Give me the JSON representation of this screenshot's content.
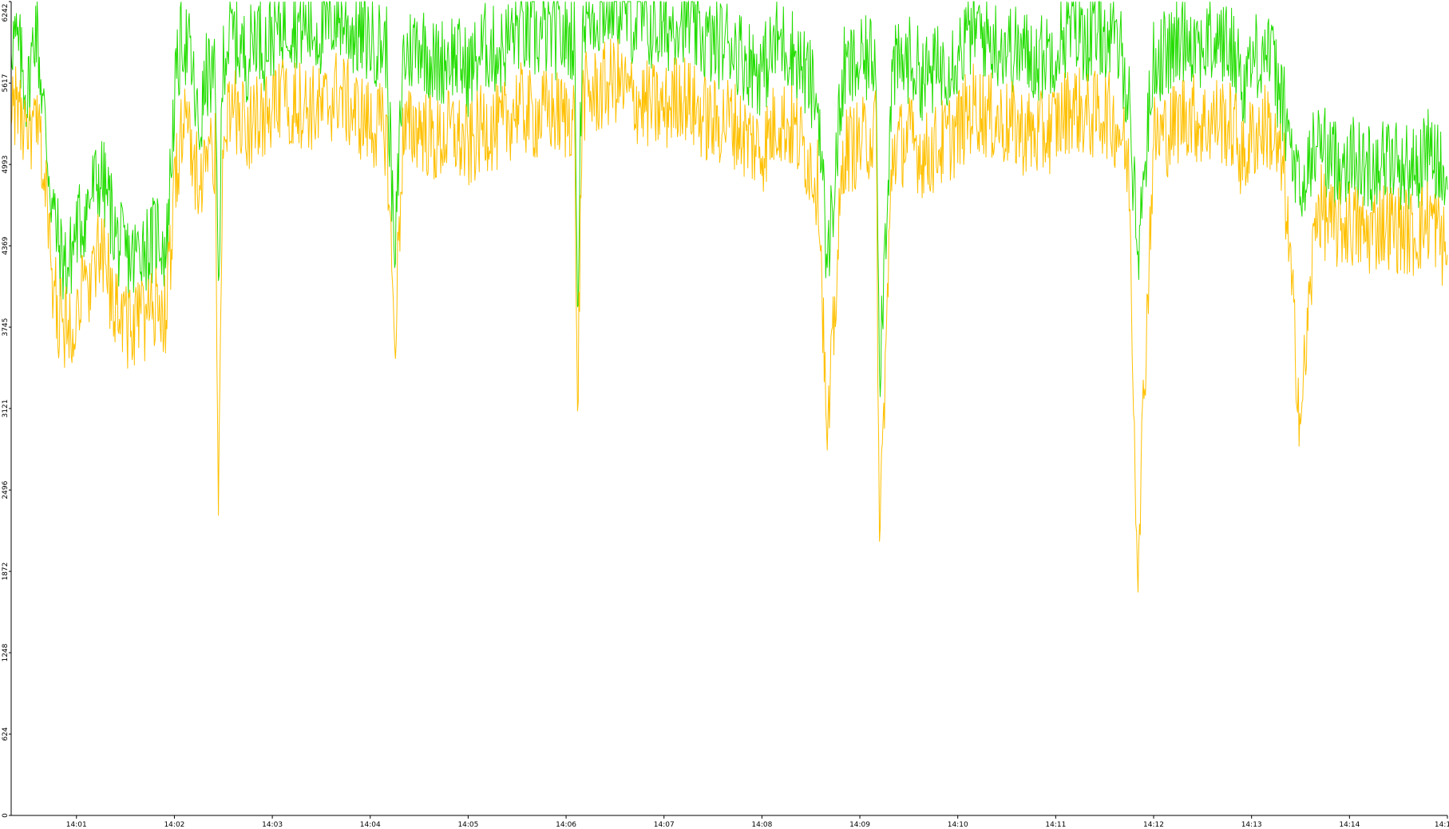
{
  "chart_data": {
    "type": "line",
    "title": "",
    "xlabel": "",
    "ylabel": "",
    "x_range": [
      "14:00:20",
      "14:15:00"
    ],
    "ylim": [
      0,
      6242
    ],
    "y_ticks": [
      0,
      624,
      1248,
      1872,
      2496,
      3121,
      3745,
      4369,
      4993,
      5617,
      6242
    ],
    "x_ticks": [
      {
        "t": "14:01:00",
        "label": "14:01"
      },
      {
        "t": "14:02:00",
        "label": "14:02"
      },
      {
        "t": "14:03:00",
        "label": "14:03"
      },
      {
        "t": "14:04:00",
        "label": "14:04"
      },
      {
        "t": "14:05:00",
        "label": "14:05"
      },
      {
        "t": "14:06:00",
        "label": "14:06"
      },
      {
        "t": "14:07:00",
        "label": "14:07"
      },
      {
        "t": "14:08:00",
        "label": "14:08"
      },
      {
        "t": "14:09:00",
        "label": "14:09"
      },
      {
        "t": "14:10:00",
        "label": "14:10"
      },
      {
        "t": "14:11:00",
        "label": "14:11"
      },
      {
        "t": "14:12:00",
        "label": "14:12"
      },
      {
        "t": "14:13:00",
        "label": "14:13"
      },
      {
        "t": "14:14:00",
        "label": "14:14"
      },
      {
        "t": "14:15:00",
        "label": "14:1"
      }
    ],
    "grid": false,
    "legend": "none",
    "series": [
      {
        "color": "#22dd00",
        "x": [
          "14:00:20",
          "14:00:25",
          "14:00:30",
          "14:00:35",
          "14:00:40",
          "14:00:45",
          "14:00:50",
          "14:00:55",
          "14:01:00",
          "14:01:05",
          "14:01:10",
          "14:01:15",
          "14:01:20",
          "14:01:25",
          "14:01:30",
          "14:01:35",
          "14:01:40",
          "14:01:45",
          "14:01:50",
          "14:01:55",
          "14:02:00",
          "14:02:05",
          "14:02:10",
          "14:02:15",
          "14:02:20",
          "14:02:25",
          "14:02:27",
          "14:02:30",
          "14:02:35",
          "14:02:40",
          "14:02:45",
          "14:02:50",
          "14:02:55",
          "14:03:00",
          "14:03:10",
          "14:03:20",
          "14:03:30",
          "14:03:40",
          "14:03:50",
          "14:04:00",
          "14:04:10",
          "14:04:15",
          "14:04:20",
          "14:04:30",
          "14:04:40",
          "14:04:50",
          "14:05:00",
          "14:05:10",
          "14:05:20",
          "14:05:30",
          "14:05:40",
          "14:05:50",
          "14:06:00",
          "14:06:05",
          "14:06:07",
          "14:06:10",
          "14:06:20",
          "14:06:30",
          "14:06:40",
          "14:06:50",
          "14:07:00",
          "14:07:10",
          "14:07:20",
          "14:07:30",
          "14:07:40",
          "14:07:50",
          "14:08:00",
          "14:08:10",
          "14:08:20",
          "14:08:30",
          "14:08:35",
          "14:08:40",
          "14:08:50",
          "14:09:00",
          "14:09:10",
          "14:09:12",
          "14:09:20",
          "14:09:30",
          "14:09:40",
          "14:09:50",
          "14:10:00",
          "14:10:10",
          "14:10:20",
          "14:10:30",
          "14:10:40",
          "14:10:50",
          "14:11:00",
          "14:11:10",
          "14:11:20",
          "14:11:30",
          "14:11:40",
          "14:11:45",
          "14:11:50",
          "14:12:00",
          "14:12:10",
          "14:12:20",
          "14:12:30",
          "14:12:40",
          "14:12:50",
          "14:12:55",
          "14:13:00",
          "14:13:10",
          "14:13:20",
          "14:13:30",
          "14:13:40",
          "14:13:50",
          "14:14:00",
          "14:14:10",
          "14:14:20",
          "14:14:30",
          "14:14:40",
          "14:14:50",
          "14:15:00"
        ],
        "y": [
          6000,
          5850,
          5500,
          6100,
          5400,
          4700,
          4300,
          4200,
          4500,
          4600,
          4800,
          4900,
          4700,
          4400,
          4300,
          4250,
          4400,
          4350,
          4500,
          4300,
          5500,
          6000,
          5800,
          5200,
          5700,
          5600,
          4100,
          5850,
          6000,
          5900,
          5800,
          6050,
          5900,
          6000,
          6100,
          6050,
          6000,
          6150,
          6000,
          5950,
          5900,
          4200,
          5800,
          5950,
          5750,
          5850,
          5700,
          5900,
          5850,
          6050,
          5950,
          6000,
          5950,
          6000,
          3900,
          6100,
          6150,
          6250,
          6100,
          6050,
          6000,
          6150,
          6000,
          5900,
          5950,
          5800,
          5700,
          5950,
          5850,
          5600,
          5400,
          4200,
          5700,
          5750,
          5850,
          3400,
          5700,
          5800,
          5650,
          5750,
          5850,
          6050,
          5950,
          5900,
          5850,
          5800,
          5900,
          6050,
          5950,
          6000,
          5850,
          5500,
          4300,
          5800,
          5850,
          6000,
          5900,
          5950,
          5850,
          5600,
          5800,
          5900,
          5400,
          4700,
          5200,
          5000,
          5050,
          4950,
          5050,
          5000,
          4950,
          5100,
          4800
        ]
      },
      {
        "color": "#ffc000",
        "x": [
          "14:00:20",
          "14:00:25",
          "14:00:30",
          "14:00:35",
          "14:00:40",
          "14:00:45",
          "14:00:50",
          "14:00:55",
          "14:01:00",
          "14:01:05",
          "14:01:10",
          "14:01:15",
          "14:01:20",
          "14:01:25",
          "14:01:30",
          "14:01:35",
          "14:01:40",
          "14:01:45",
          "14:01:50",
          "14:01:55",
          "14:02:00",
          "14:02:05",
          "14:02:10",
          "14:02:15",
          "14:02:20",
          "14:02:25",
          "14:02:27",
          "14:02:30",
          "14:02:35",
          "14:02:40",
          "14:02:45",
          "14:02:50",
          "14:02:55",
          "14:03:00",
          "14:03:10",
          "14:03:20",
          "14:03:30",
          "14:03:40",
          "14:03:50",
          "14:04:00",
          "14:04:10",
          "14:04:15",
          "14:04:20",
          "14:04:30",
          "14:04:40",
          "14:04:50",
          "14:05:00",
          "14:05:10",
          "14:05:20",
          "14:05:30",
          "14:05:40",
          "14:05:50",
          "14:06:00",
          "14:06:05",
          "14:06:07",
          "14:06:10",
          "14:06:20",
          "14:06:30",
          "14:06:40",
          "14:06:50",
          "14:07:00",
          "14:07:10",
          "14:07:20",
          "14:07:30",
          "14:07:40",
          "14:07:50",
          "14:08:00",
          "14:08:10",
          "14:08:20",
          "14:08:30",
          "14:08:35",
          "14:08:40",
          "14:08:50",
          "14:09:00",
          "14:09:10",
          "14:09:12",
          "14:09:20",
          "14:09:30",
          "14:09:40",
          "14:09:50",
          "14:10:00",
          "14:10:10",
          "14:10:20",
          "14:10:30",
          "14:10:40",
          "14:10:50",
          "14:11:00",
          "14:11:10",
          "14:11:20",
          "14:11:30",
          "14:11:40",
          "14:11:45",
          "14:11:50",
          "14:12:00",
          "14:12:10",
          "14:12:20",
          "14:12:30",
          "14:12:40",
          "14:12:50",
          "14:12:55",
          "14:13:00",
          "14:13:10",
          "14:13:20",
          "14:13:30",
          "14:13:40",
          "14:13:50",
          "14:14:00",
          "14:14:10",
          "14:14:20",
          "14:14:30",
          "14:14:40",
          "14:14:50",
          "14:15:00"
        ],
        "y": [
          5500,
          5400,
          5100,
          5300,
          5000,
          4100,
          3800,
          3700,
          3950,
          4000,
          4200,
          4300,
          4100,
          3900,
          3800,
          3700,
          3850,
          3800,
          3950,
          3800,
          4800,
          5300,
          5200,
          4800,
          5150,
          5050,
          2300,
          5300,
          5400,
          5350,
          5250,
          5450,
          5300,
          5400,
          5500,
          5450,
          5400,
          5550,
          5400,
          5300,
          5250,
          3600,
          5200,
          5300,
          5150,
          5250,
          5100,
          5300,
          5250,
          5450,
          5350,
          5400,
          5350,
          5400,
          3100,
          5500,
          5550,
          5650,
          5500,
          5450,
          5400,
          5550,
          5400,
          5300,
          5350,
          5200,
          5100,
          5350,
          5250,
          5000,
          4800,
          2800,
          5100,
          5150,
          5250,
          2100,
          5100,
          5200,
          5050,
          5150,
          5250,
          5450,
          5350,
          5300,
          5250,
          5200,
          5300,
          5450,
          5350,
          5400,
          5250,
          4900,
          1900,
          5200,
          5250,
          5400,
          5300,
          5350,
          5250,
          5000,
          5200,
          5300,
          4900,
          3000,
          4700,
          4500,
          4550,
          4450,
          4550,
          4500,
          4450,
          4600,
          4300
        ]
      }
    ]
  }
}
